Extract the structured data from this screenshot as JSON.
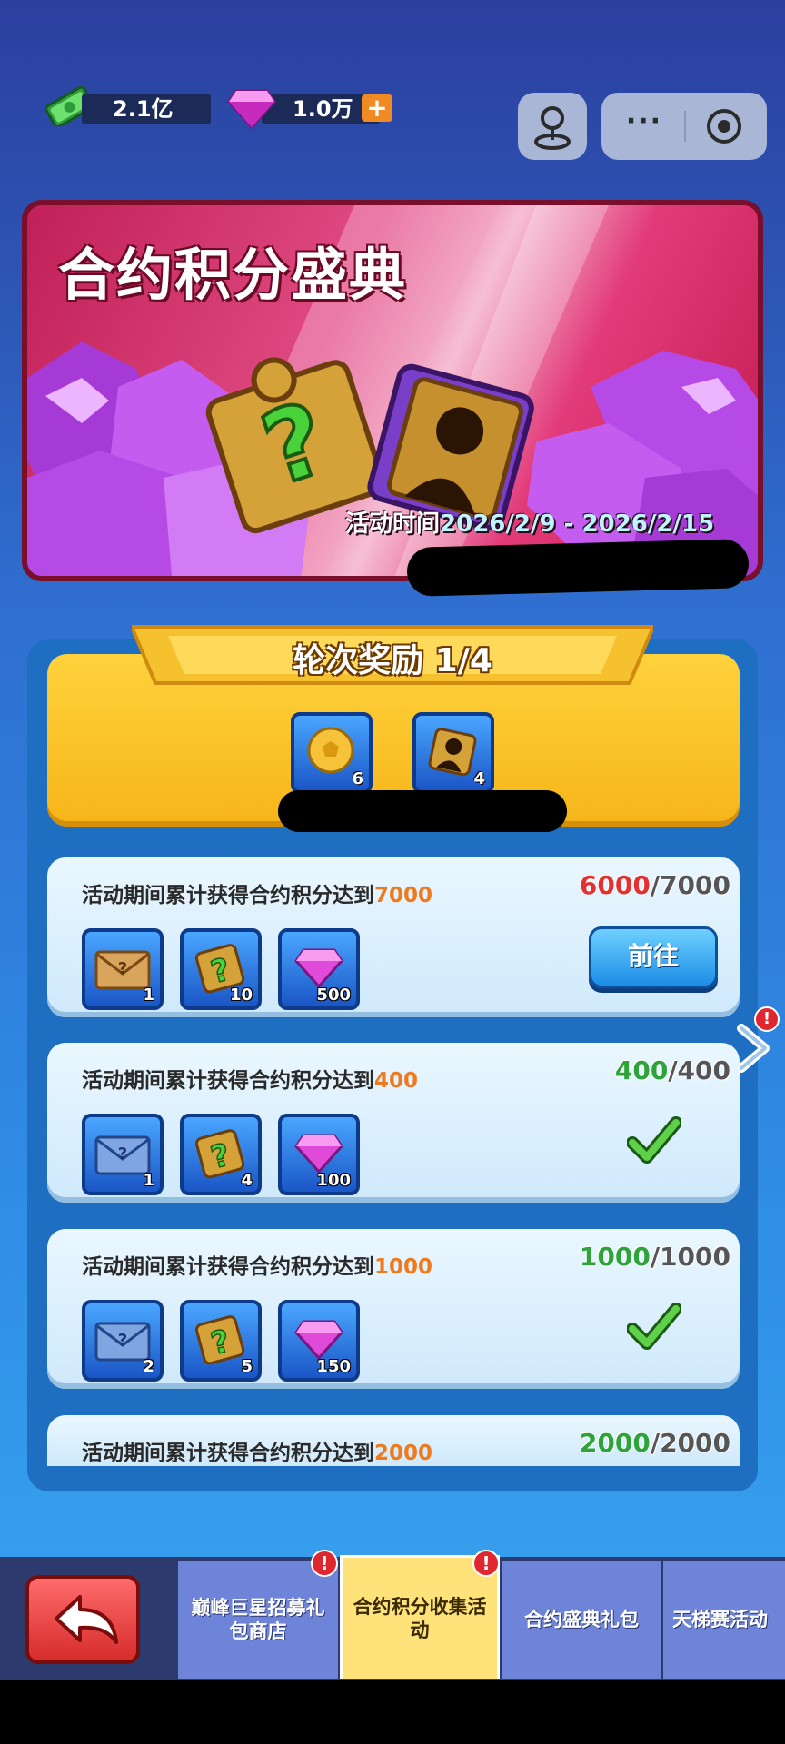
{
  "currency": {
    "cash_value": "2.1亿",
    "gem_value": "1.0万",
    "plus_label": "+"
  },
  "top_right": {
    "more_label": "···"
  },
  "banner": {
    "title": "合约积分盛典",
    "time_label": "活动时间",
    "time_range": "2026/2/9 - 2026/2/15"
  },
  "round_rewards": {
    "title": "轮次奖励 1/4",
    "items": [
      {
        "icon": "gold-ball-icon",
        "count": "6"
      },
      {
        "icon": "silhouette-puzzle-icon",
        "count": "4"
      }
    ]
  },
  "tasks": [
    {
      "desc_prefix": "活动期间累计获得合约积分达到",
      "target": "7000",
      "current": "6000",
      "total": "/7000",
      "status": "go",
      "button_label": "前往",
      "rewards": [
        {
          "icon": "gold-envelope-icon",
          "count": "1"
        },
        {
          "icon": "mystery-puzzle-icon",
          "count": "10"
        },
        {
          "icon": "gem-icon",
          "count": "500"
        }
      ]
    },
    {
      "desc_prefix": "活动期间累计获得合约积分达到",
      "target": "400",
      "current": "400",
      "total": "/400",
      "status": "done",
      "rewards": [
        {
          "icon": "blue-envelope-icon",
          "count": "1"
        },
        {
          "icon": "mystery-puzzle-icon",
          "count": "4"
        },
        {
          "icon": "gem-icon",
          "count": "100"
        }
      ]
    },
    {
      "desc_prefix": "活动期间累计获得合约积分达到",
      "target": "1000",
      "current": "1000",
      "total": "/1000",
      "status": "done",
      "rewards": [
        {
          "icon": "blue-envelope-icon",
          "count": "2"
        },
        {
          "icon": "mystery-puzzle-icon",
          "count": "5"
        },
        {
          "icon": "gem-icon",
          "count": "150"
        }
      ]
    },
    {
      "desc_prefix": "活动期间累计获得合约积分达到",
      "target": "2000",
      "current": "2000",
      "total": "/2000",
      "status": "done"
    }
  ],
  "side_badge": "!",
  "tabs": [
    {
      "label": "巅峰巨星招募礼包商店",
      "badge": "!"
    },
    {
      "label": "合约积分收集活动",
      "badge": "!",
      "active": true
    },
    {
      "label": "合约盛典礼包"
    },
    {
      "label": "天梯赛活动"
    }
  ],
  "colors": {
    "target_orange": "#ee7a1d",
    "progress_red": "#e33131",
    "progress_green": "#2ea33a",
    "active_tab": "#ffe27a",
    "tab": "#6e84d8"
  }
}
